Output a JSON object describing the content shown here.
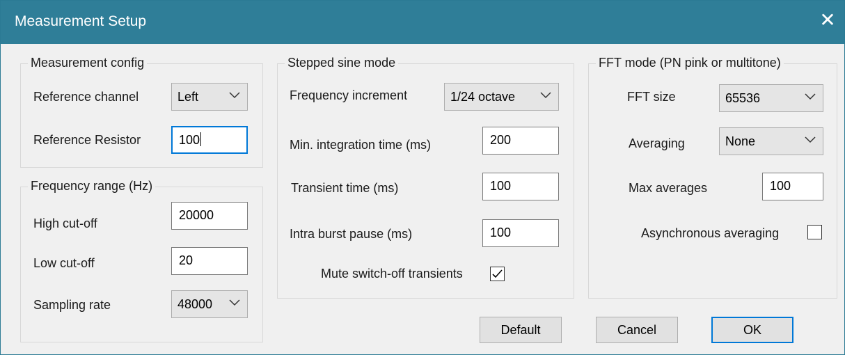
{
  "window": {
    "title": "Measurement Setup",
    "close_icon": "close-icon"
  },
  "measurement_config": {
    "title": "Measurement config",
    "reference_channel_label": "Reference channel",
    "reference_channel_value": "Left",
    "reference_resistor_label": "Reference Resistor",
    "reference_resistor_value": "100"
  },
  "frequency_range": {
    "title": "Frequency range (Hz)",
    "high_cutoff_label": "High cut-off",
    "high_cutoff_value": "20000",
    "low_cutoff_label": "Low cut-off",
    "low_cutoff_value": "20",
    "sampling_rate_label": "Sampling rate",
    "sampling_rate_value": "48000"
  },
  "stepped_sine": {
    "title": "Stepped sine mode",
    "frequency_increment_label": "Frequency increment",
    "frequency_increment_value": "1/24 octave",
    "min_integration_label": "Min. integration time (ms)",
    "min_integration_value": "200",
    "transient_time_label": "Transient time (ms)",
    "transient_time_value": "100",
    "intra_burst_label": "Intra burst pause (ms)",
    "intra_burst_value": "100",
    "mute_label": "Mute switch-off transients",
    "mute_checked": true
  },
  "fft_mode": {
    "title": "FFT mode (PN pink or multitone)",
    "fft_size_label": "FFT size",
    "fft_size_value": "65536",
    "averaging_label": "Averaging",
    "averaging_value": "None",
    "max_averages_label": "Max averages",
    "max_averages_value": "100",
    "async_label": "Asynchronous averaging",
    "async_checked": false
  },
  "buttons": {
    "default": "Default",
    "cancel": "Cancel",
    "ok": "OK"
  },
  "colors": {
    "titlebar": "#2f7e98",
    "focus": "#0078d7",
    "background": "#f0f0f0"
  }
}
